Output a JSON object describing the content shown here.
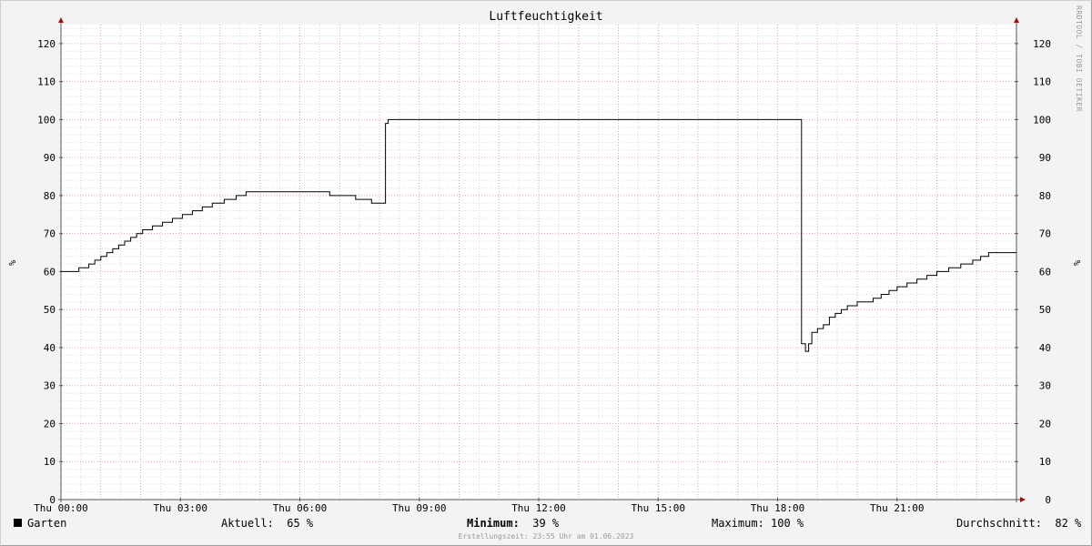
{
  "chart_data": {
    "type": "line",
    "title": "Luftfeuchtigkeit",
    "ylabel": "%",
    "ylim": [
      0,
      125
    ],
    "y_ticks": [
      0,
      10,
      20,
      30,
      40,
      50,
      60,
      70,
      80,
      90,
      100,
      110,
      120
    ],
    "x_range_hours": [
      0,
      24
    ],
    "x_ticks": [
      {
        "hour": 0,
        "label": "Thu 00:00"
      },
      {
        "hour": 3,
        "label": "Thu 03:00"
      },
      {
        "hour": 6,
        "label": "Thu 06:00"
      },
      {
        "hour": 9,
        "label": "Thu 09:00"
      },
      {
        "hour": 12,
        "label": "Thu 12:00"
      },
      {
        "hour": 15,
        "label": "Thu 15:00"
      },
      {
        "hour": 18,
        "label": "Thu 18:00"
      },
      {
        "hour": 21,
        "label": "Thu 21:00"
      }
    ],
    "grid": true,
    "series": [
      {
        "name": "Garten",
        "color": "#000000",
        "step": true,
        "points": [
          [
            0.0,
            60
          ],
          [
            0.45,
            61
          ],
          [
            0.7,
            62
          ],
          [
            0.85,
            63
          ],
          [
            1.0,
            64
          ],
          [
            1.15,
            65
          ],
          [
            1.3,
            66
          ],
          [
            1.45,
            67
          ],
          [
            1.6,
            68
          ],
          [
            1.75,
            69
          ],
          [
            1.9,
            70
          ],
          [
            2.05,
            71
          ],
          [
            2.3,
            72
          ],
          [
            2.55,
            73
          ],
          [
            2.8,
            74
          ],
          [
            3.05,
            75
          ],
          [
            3.3,
            76
          ],
          [
            3.55,
            77
          ],
          [
            3.8,
            78
          ],
          [
            4.1,
            79
          ],
          [
            4.4,
            80
          ],
          [
            4.65,
            81
          ],
          [
            6.75,
            80
          ],
          [
            7.4,
            79
          ],
          [
            7.8,
            78
          ],
          [
            8.15,
            99
          ],
          [
            8.22,
            100
          ],
          [
            18.6,
            41
          ],
          [
            18.7,
            39
          ],
          [
            18.78,
            41
          ],
          [
            18.86,
            44
          ],
          [
            19.0,
            45
          ],
          [
            19.15,
            46
          ],
          [
            19.3,
            48
          ],
          [
            19.45,
            49
          ],
          [
            19.6,
            50
          ],
          [
            19.75,
            51
          ],
          [
            20.0,
            52
          ],
          [
            20.4,
            53
          ],
          [
            20.6,
            54
          ],
          [
            20.8,
            55
          ],
          [
            21.0,
            56
          ],
          [
            21.25,
            57
          ],
          [
            21.5,
            58
          ],
          [
            21.75,
            59
          ],
          [
            22.0,
            60
          ],
          [
            22.3,
            61
          ],
          [
            22.6,
            62
          ],
          [
            22.9,
            63
          ],
          [
            23.1,
            64
          ],
          [
            23.3,
            65
          ],
          [
            24.0,
            65
          ]
        ]
      }
    ]
  },
  "legend": {
    "series_name": "Garten",
    "aktuell_label": "Aktuell:",
    "aktuell_value": "65 %",
    "minimum_label": "Minimum:",
    "minimum_value": "39 %",
    "maximum_label": "Maximum:",
    "maximum_value": "100 %",
    "durchschnitt_label": "Durchschnitt:",
    "durchschnitt_value": "82 %"
  },
  "footer": "Erstellungszeit: 23:55 Uhr am 01.06.2023",
  "watermark": "RRDTOOL / TOBI OETIKER",
  "colors": {
    "background": "#f3f3f3",
    "plot_background": "#ffffff",
    "major_grid": "#e8a0a0",
    "minor_grid": "#d8d8d8",
    "axis": "#555555",
    "arrow": "#a01010"
  }
}
